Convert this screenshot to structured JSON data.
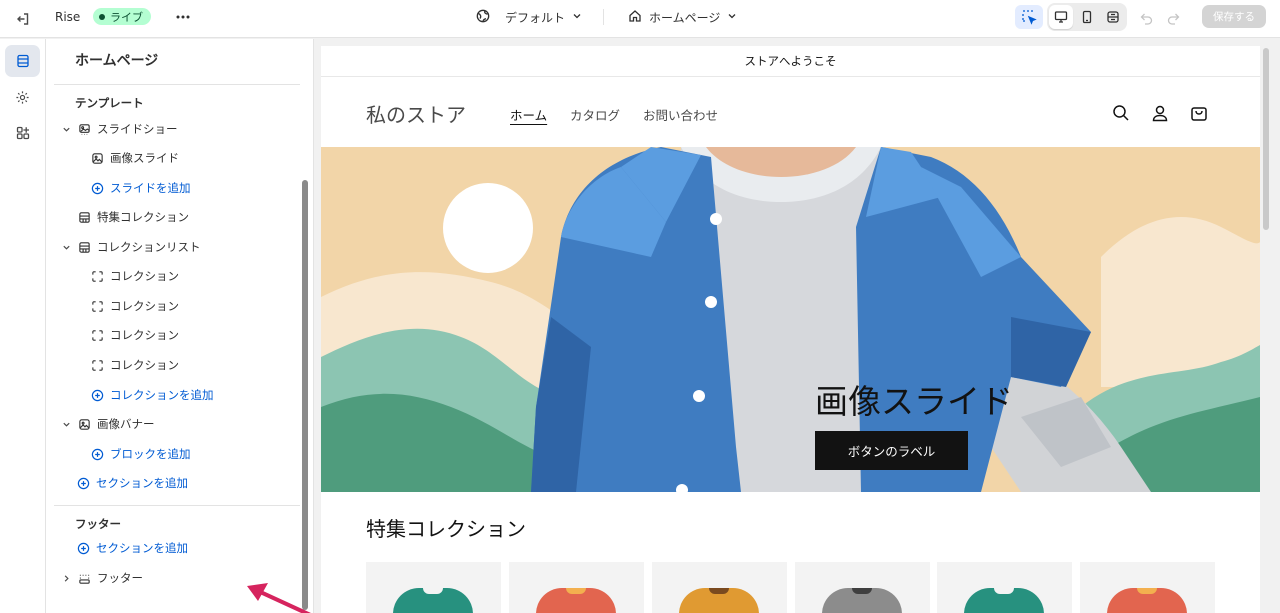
{
  "topbar": {
    "theme_name": "Rise",
    "live_badge": "ライブ",
    "preset": "デフォルト",
    "page": "ホームページ",
    "save": "保存する"
  },
  "panel": {
    "title": "ホームページ",
    "template_label": "テンプレート",
    "template_items": [
      "スライドショー",
      "画像スライド",
      "スライドを追加",
      "特集コレクション",
      "コレクションリスト",
      "コレクション",
      "コレクション",
      "コレクション",
      "コレクション",
      "コレクションを追加",
      "画像バナー",
      "ブロックを追加",
      "セクションを追加"
    ],
    "footer_label": "フッター",
    "footer_add_section": "セクションを追加",
    "footer_item": "フッター"
  },
  "preview": {
    "announcement": "ストアへようこそ",
    "store_name": "私のストア",
    "nav": [
      "ホーム",
      "カタログ",
      "お問い合わせ"
    ],
    "hero_title": "画像スライド",
    "hero_button": "ボタンのラベル",
    "featured_title": "特集コレクション",
    "product_colors": [
      "#27917f",
      "#e2654f",
      "#e09a32",
      "#8c8c8c",
      "#27917f",
      "#e2654f"
    ]
  },
  "colors": {
    "accent_blue": "#005bd3",
    "live_green": "#b4fed2",
    "annotation_arrow": "#d6245e"
  }
}
